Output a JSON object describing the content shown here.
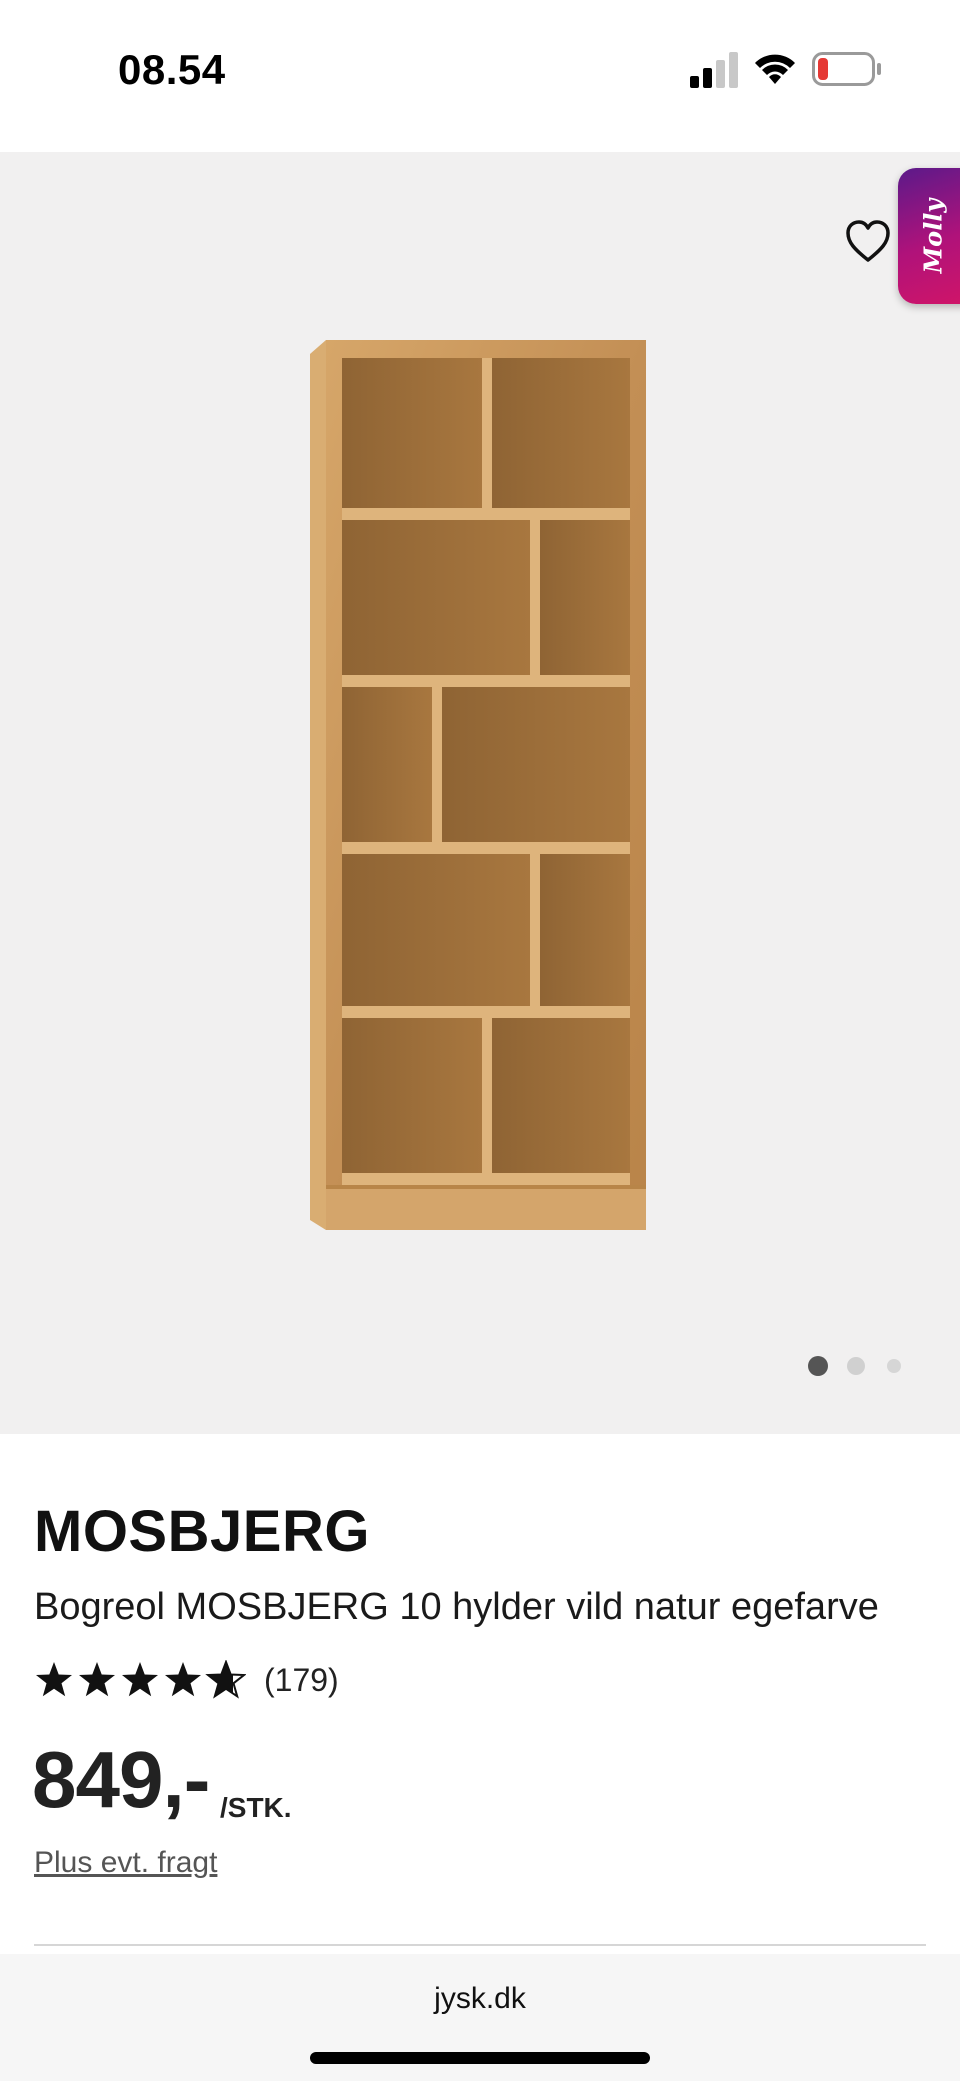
{
  "status_bar": {
    "time": "08.54",
    "icons": [
      "cellular-signal-icon",
      "wifi-icon",
      "battery-low-icon"
    ],
    "battery_color": "#e53935"
  },
  "gallery": {
    "image": "bookshelf-product-image",
    "wishlist_icon": "heart-outline-icon",
    "chat_label": "Molly",
    "slide_count": 3,
    "active_slide": 1
  },
  "product": {
    "brand": "MOSBJERG",
    "title": "Bogreol MOSBJERG 10 hylder vild natur egefarve",
    "rating": 4.7,
    "rating_max": 5,
    "review_count": "(179)",
    "price": "849,-",
    "unit": "/STK.",
    "freight_link": "Plus evt. fragt"
  },
  "browser": {
    "url": "jysk.dk"
  },
  "colors": {
    "gallery_bg": "#f1f0f0",
    "chat_gradient_start": "#5b1a8a",
    "chat_gradient_end": "#d01568",
    "wood": "#c9975a"
  }
}
